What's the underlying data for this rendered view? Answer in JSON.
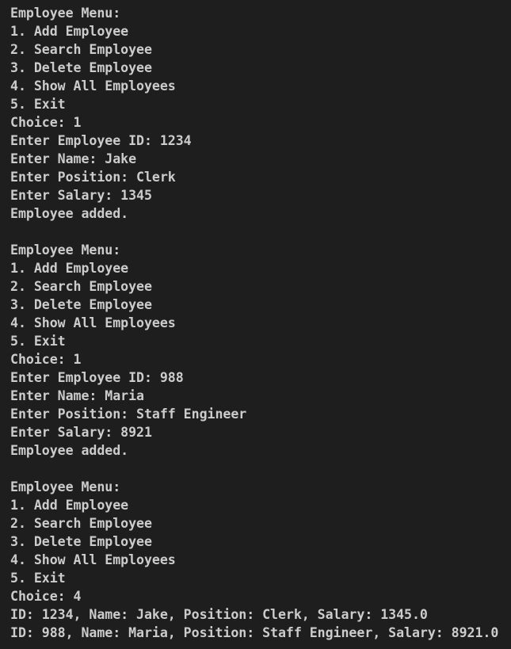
{
  "terminal": {
    "lines": [
      "Employee Menu:",
      "1. Add Employee",
      "2. Search Employee",
      "3. Delete Employee",
      "4. Show All Employees",
      "5. Exit",
      "Choice: 1",
      "Enter Employee ID: 1234",
      "Enter Name: Jake",
      "Enter Position: Clerk",
      "Enter Salary: 1345",
      "Employee added.",
      "",
      "Employee Menu:",
      "1. Add Employee",
      "2. Search Employee",
      "3. Delete Employee",
      "4. Show All Employees",
      "5. Exit",
      "Choice: 1",
      "Enter Employee ID: 988",
      "Enter Name: Maria",
      "Enter Position: Staff Engineer",
      "Enter Salary: 8921",
      "Employee added.",
      "",
      "Employee Menu:",
      "1. Add Employee",
      "2. Search Employee",
      "3. Delete Employee",
      "4. Show All Employees",
      "5. Exit",
      "Choice: 4",
      "ID: 1234, Name: Jake, Position: Clerk, Salary: 1345.0",
      "ID: 988, Name: Maria, Position: Staff Engineer, Salary: 8921.0"
    ]
  }
}
